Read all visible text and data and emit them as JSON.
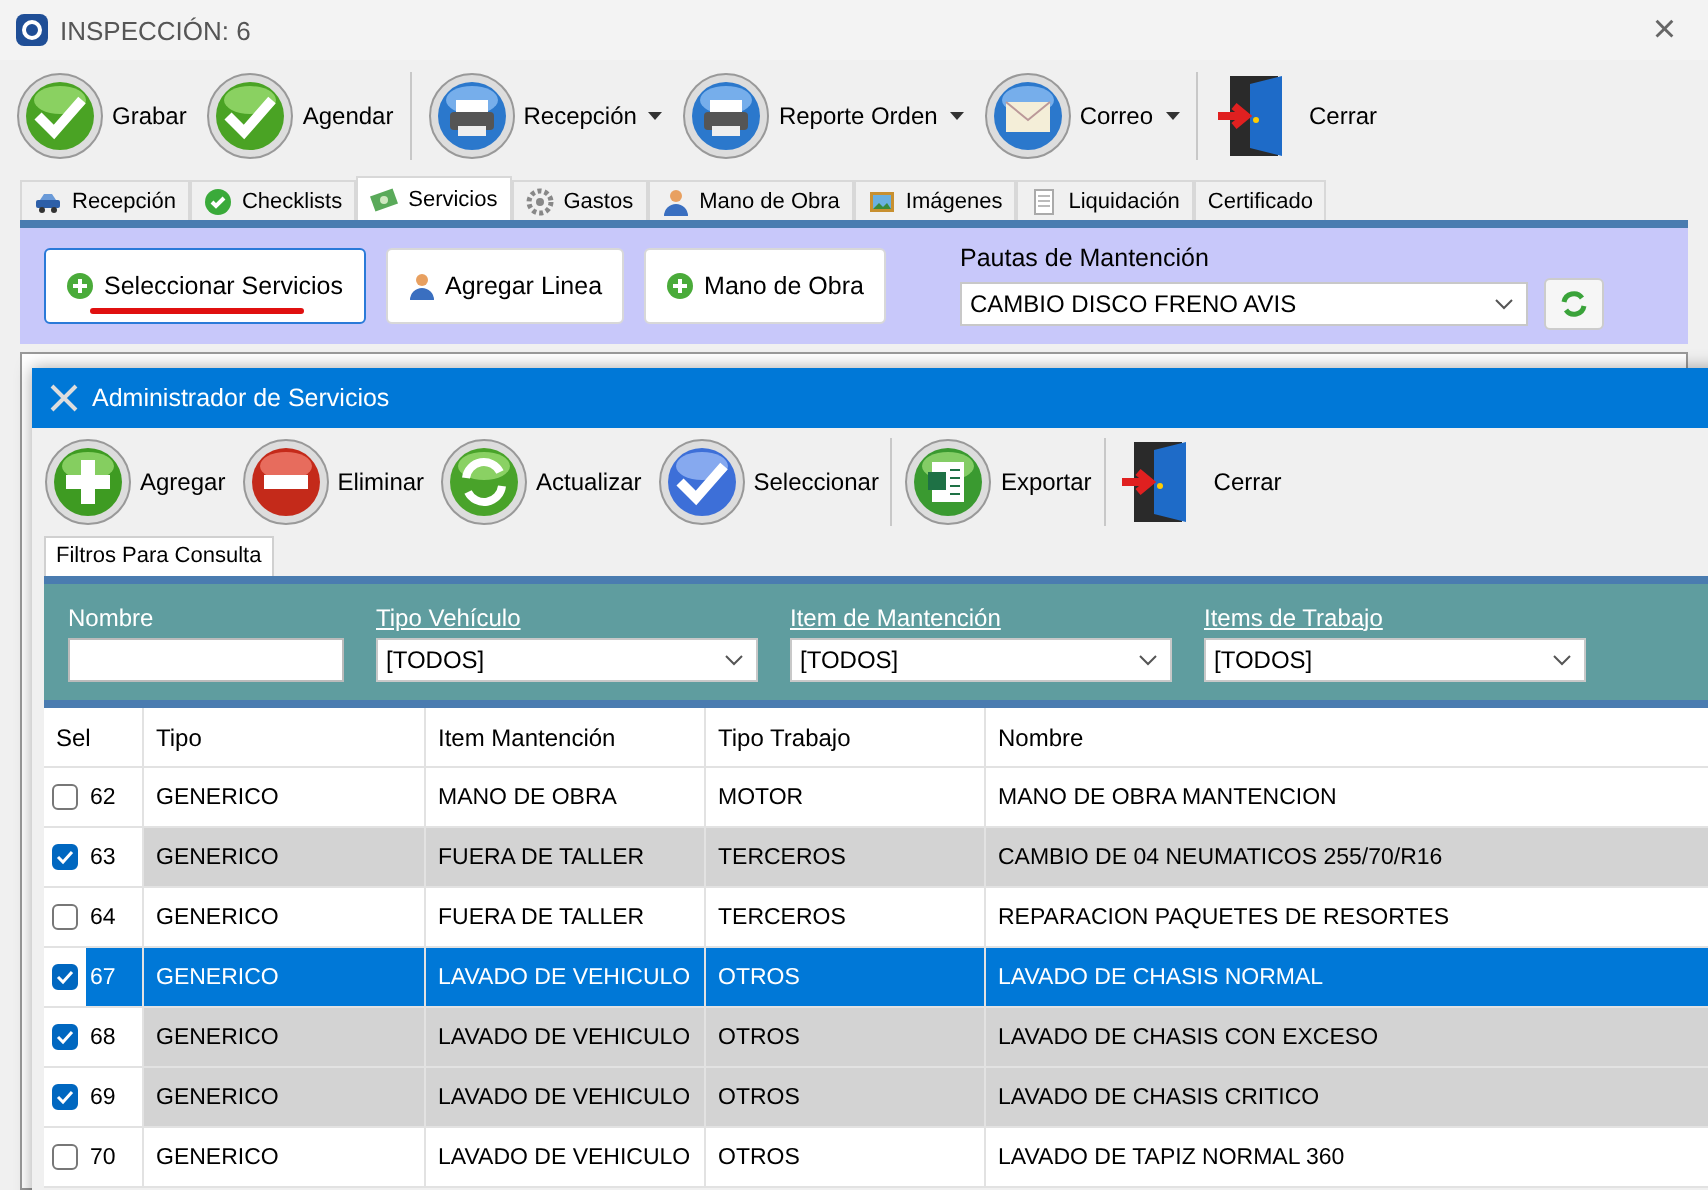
{
  "window": {
    "title": "INSPECCIÓN: 6",
    "close": "×"
  },
  "toolbar": [
    "Grabar",
    "Agendar",
    "Recepción",
    "Reporte Orden",
    "Correo",
    "Cerrar"
  ],
  "tabs": [
    {
      "label": "Recepción",
      "selected": false
    },
    {
      "label": "Checklists",
      "selected": false
    },
    {
      "label": "Servicios",
      "selected": true
    },
    {
      "label": "Gastos",
      "selected": false
    },
    {
      "label": "Mano de Obra",
      "selected": false
    },
    {
      "label": "Imágenes",
      "selected": false
    },
    {
      "label": "Liquidación",
      "selected": false
    },
    {
      "label": "Certificado",
      "selected": false
    }
  ],
  "services_panel": {
    "buttons": [
      {
        "label": "Seleccionar Servicios",
        "selected": true
      },
      {
        "label": "Agregar Linea",
        "selected": false
      },
      {
        "label": "Mano de Obra",
        "selected": false
      }
    ],
    "pautas_label": "Pautas de Mantención",
    "pautas_value": "CAMBIO DISCO FRENO AVIS"
  },
  "dialog": {
    "title": "Administrador de Servicios",
    "toolbar": [
      "Agregar",
      "Eliminar",
      "Actualizar",
      "Seleccionar",
      "Exportar",
      "Cerrar"
    ],
    "filter_tab": "Filtros Para Consulta",
    "filters": [
      {
        "label": "Nombre",
        "kind": "text"
      },
      {
        "label": "Tipo Vehículo",
        "kind": "select",
        "value": "[TODOS]"
      },
      {
        "label": "Item de Mantención",
        "kind": "select",
        "value": "[TODOS]"
      },
      {
        "label": "Items de Trabajo",
        "kind": "select",
        "value": "[TODOS]"
      }
    ],
    "table": {
      "columns": [
        "Sel",
        "Tipo",
        "Item Mantención",
        "Tipo Trabajo",
        "Nombre"
      ],
      "rows": [
        {
          "id": "62",
          "tipo": "GENERICO",
          "item": "MANO DE OBRA",
          "trabajo": "MOTOR",
          "nombre": "MANO DE OBRA MANTENCION",
          "checked": false,
          "selected": false
        },
        {
          "id": "63",
          "tipo": "GENERICO",
          "item": "FUERA DE TALLER",
          "trabajo": "TERCEROS",
          "nombre": "CAMBIO DE 04 NEUMATICOS 255/70/R16",
          "checked": true,
          "selected": false
        },
        {
          "id": "64",
          "tipo": "GENERICO",
          "item": "FUERA DE TALLER",
          "trabajo": "TERCEROS",
          "nombre": "REPARACION PAQUETES DE RESORTES",
          "checked": false,
          "selected": false
        },
        {
          "id": "67",
          "tipo": "GENERICO",
          "item": "LAVADO DE VEHICULO",
          "trabajo": "OTROS",
          "nombre": "LAVADO DE CHASIS NORMAL",
          "checked": true,
          "selected": true
        },
        {
          "id": "68",
          "tipo": "GENERICO",
          "item": "LAVADO DE VEHICULO",
          "trabajo": "OTROS",
          "nombre": "LAVADO DE CHASIS CON EXCESO",
          "checked": true,
          "selected": false
        },
        {
          "id": "69",
          "tipo": "GENERICO",
          "item": "LAVADO DE VEHICULO",
          "trabajo": "OTROS",
          "nombre": "LAVADO DE CHASIS CRITICO",
          "checked": true,
          "selected": false
        },
        {
          "id": "70",
          "tipo": "GENERICO",
          "item": "LAVADO DE VEHICULO",
          "trabajo": "OTROS",
          "nombre": "LAVADO DE TAPIZ NORMAL 360",
          "checked": false,
          "selected": false
        }
      ]
    }
  }
}
